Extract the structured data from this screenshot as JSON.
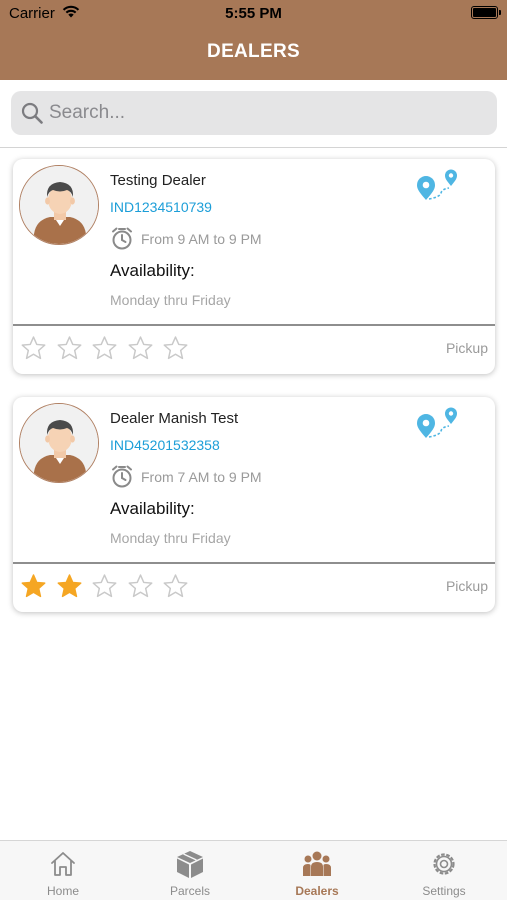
{
  "status_bar": {
    "carrier": "Carrier",
    "time": "5:55 PM"
  },
  "header": {
    "title": "DEALERS"
  },
  "search": {
    "placeholder": "Search..."
  },
  "dealers": [
    {
      "name": "Testing Dealer",
      "code": "IND1234510739",
      "hours": "From 9 AM to 9 PM",
      "availability_label": "Availability:",
      "days": "Monday thru Friday",
      "rating": 0,
      "max_rating": 5,
      "service": "Pickup"
    },
    {
      "name": "Dealer Manish Test",
      "code": "IND45201532358",
      "hours": "From 7 AM to 9 PM",
      "availability_label": "Availability:",
      "days": "Monday thru Friday",
      "rating": 2,
      "max_rating": 5,
      "service": "Pickup"
    }
  ],
  "tabs": [
    {
      "label": "Home",
      "icon": "home-icon",
      "active": false
    },
    {
      "label": "Parcels",
      "icon": "parcels-box-icon",
      "active": false
    },
    {
      "label": "Dealers",
      "icon": "dealers-group-icon",
      "active": true
    },
    {
      "label": "Settings",
      "icon": "settings-gear-icon",
      "active": false
    }
  ],
  "colors": {
    "brand": "#a77857",
    "link": "#1c9ed8",
    "star_filled": "#f5a623",
    "star_empty": "#c9c9c9",
    "tab_inactive": "#8c8c8c"
  }
}
